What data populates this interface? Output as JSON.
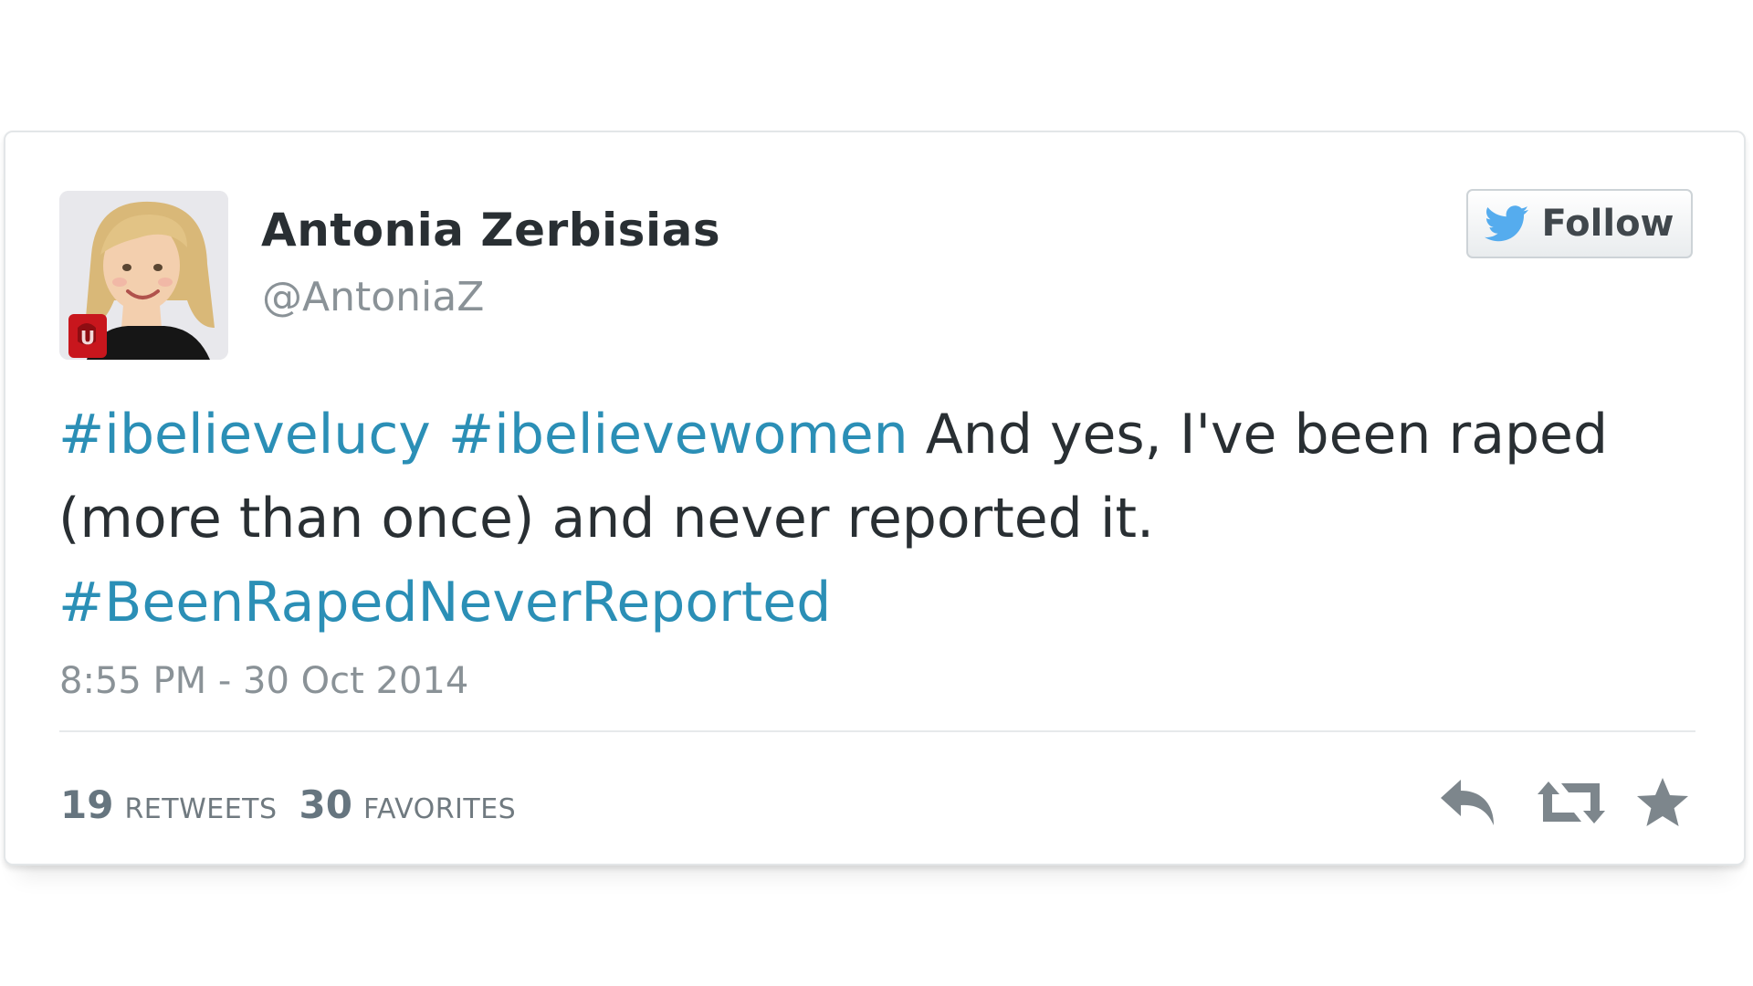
{
  "tweet": {
    "author": {
      "display_name": "Antonia Zerbisias",
      "handle": "@AntoniaZ"
    },
    "follow_button": {
      "label": "Follow",
      "icon": "twitter-bird-icon"
    },
    "text": {
      "hashtag1": "#ibelievelucy",
      "hashtag2": "#ibelievewomen",
      "body": "And yes, I've been raped (more than once) and never reported it.",
      "hashtag3": "#BeenRapedNeverReported"
    },
    "timestamp": "8:55 PM - 30 Oct 2014",
    "stats": {
      "retweets_count": "19",
      "retweets_label": "RETWEETS",
      "favorites_count": "30",
      "favorites_label": "FAVORITES"
    },
    "actions": [
      "reply-icon",
      "retweet-icon",
      "favorite-icon"
    ]
  },
  "colors": {
    "hashtag": "#2b8fb6",
    "twitter_blue": "#55acee",
    "text": "#292f33",
    "muted": "#8a9297",
    "action_icon": "#7d868c"
  }
}
